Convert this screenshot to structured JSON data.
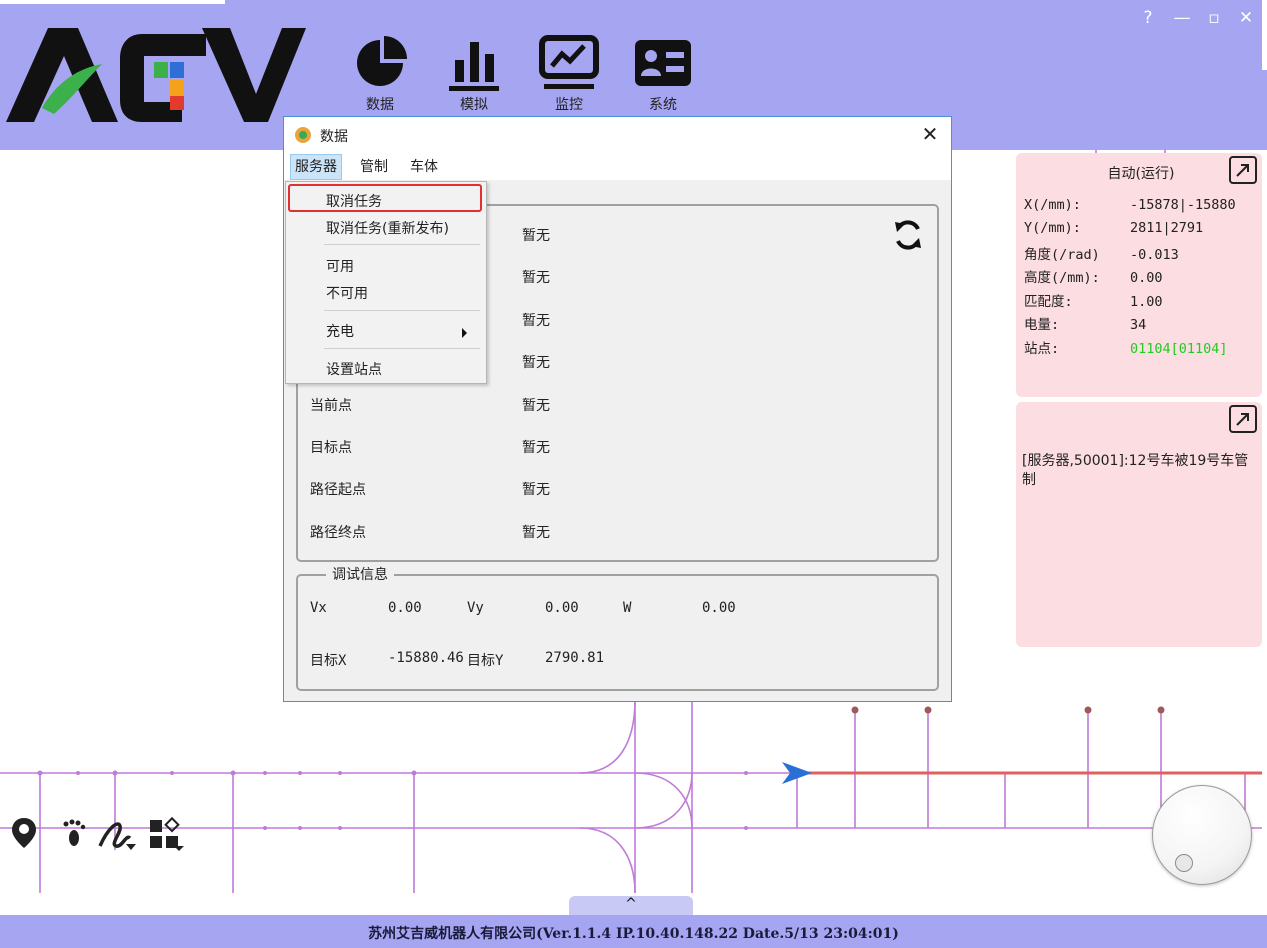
{
  "header": {
    "logo_text": "AGV",
    "nav": [
      {
        "label": "数据",
        "icon": "pie-chart-icon"
      },
      {
        "label": "模拟",
        "icon": "bar-chart-icon"
      },
      {
        "label": "监控",
        "icon": "monitor-icon"
      },
      {
        "label": "系统",
        "icon": "id-card-icon"
      }
    ],
    "window_controls": {
      "help": "?",
      "minimize": "—",
      "maximize": "▫",
      "close": "✕"
    },
    "background_color": "#a5a5f2"
  },
  "dialog": {
    "title": "数据",
    "close_glyph": "✕",
    "menubar": [
      "服务器",
      "管制",
      "车体"
    ],
    "dropdown": {
      "items": [
        {
          "label": "取消任务",
          "highlighted": true
        },
        {
          "label": "取消任务(重新发布)"
        },
        {
          "label": "可用"
        },
        {
          "label": "不可用"
        },
        {
          "label": "充电",
          "has_submenu": true
        },
        {
          "label": "设置站点"
        }
      ]
    },
    "info_rows": [
      {
        "label": "",
        "value": "暂无"
      },
      {
        "label": "",
        "value": "暂无"
      },
      {
        "label": "",
        "value": "暂无"
      },
      {
        "label": "",
        "value": "暂无"
      },
      {
        "label": "当前点",
        "value": "暂无"
      },
      {
        "label": "目标点",
        "value": "暂无"
      },
      {
        "label": "路径起点",
        "value": "暂无"
      },
      {
        "label": "路径终点",
        "value": "暂无"
      }
    ],
    "debug": {
      "legend": "调试信息",
      "vx_label": "Vx",
      "vx_value": "0.00",
      "vy_label": "Vy",
      "vy_value": "0.00",
      "w_label": "W",
      "w_value": "0.00",
      "target_x_label": "目标X",
      "target_x_value": "-15880.46",
      "target_y_label": "目标Y",
      "target_y_value": "2790.81"
    }
  },
  "status_panel": {
    "mode": "自动(运行)",
    "rows": [
      {
        "label": "X(/mm):",
        "value": "-15878|-15880"
      },
      {
        "label": "Y(/mm):",
        "value": "2811|2791"
      },
      {
        "label": "角度(/rad)",
        "value": "-0.013"
      },
      {
        "label": "高度(/mm):",
        "value": "0.00"
      },
      {
        "label": "匹配度:",
        "value": "1.00"
      },
      {
        "label": "电量:",
        "value": "34"
      },
      {
        "label": "站点:",
        "value": "01104[01104]",
        "color": "#22cc22"
      }
    ]
  },
  "log_panel": {
    "message": "[服务器,50001]:12号车被19号车管制"
  },
  "footer": {
    "text": "苏州艾吉威机器人有限公司(Ver.1.1.4 IP.10.40.148.22 Date.5/13 23:04:01)",
    "collapse_glyph": "^"
  },
  "colors": {
    "route_line": "#c07ad8",
    "active_path": "#e06060",
    "vehicle_arrow": "#2a6fd6",
    "panel_bg": "#fbdde2"
  }
}
